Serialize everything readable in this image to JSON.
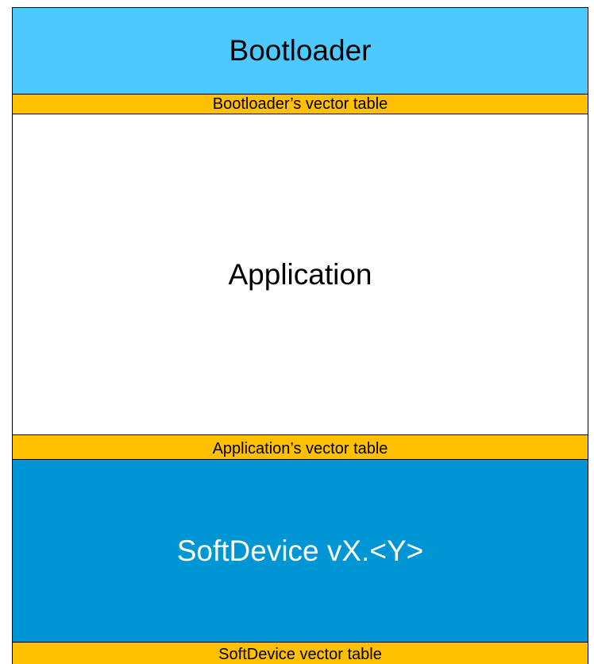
{
  "diagram": {
    "regions": {
      "bootloader": {
        "label": "Bootloader",
        "color": "#4ec9ff"
      },
      "bootloader_vector_table": {
        "label": "Bootloader’s vector table",
        "color": "#ffc000"
      },
      "application": {
        "label": "Application",
        "color": "#ffffff"
      },
      "application_vector_table": {
        "label": "Application’s vector table",
        "color": "#ffc000"
      },
      "softdevice": {
        "label": "SoftDevice vX.<Y>",
        "color": "#0096d6"
      },
      "softdevice_vector_table": {
        "label": "SoftDevice vector table",
        "color": "#ffc000"
      }
    }
  }
}
